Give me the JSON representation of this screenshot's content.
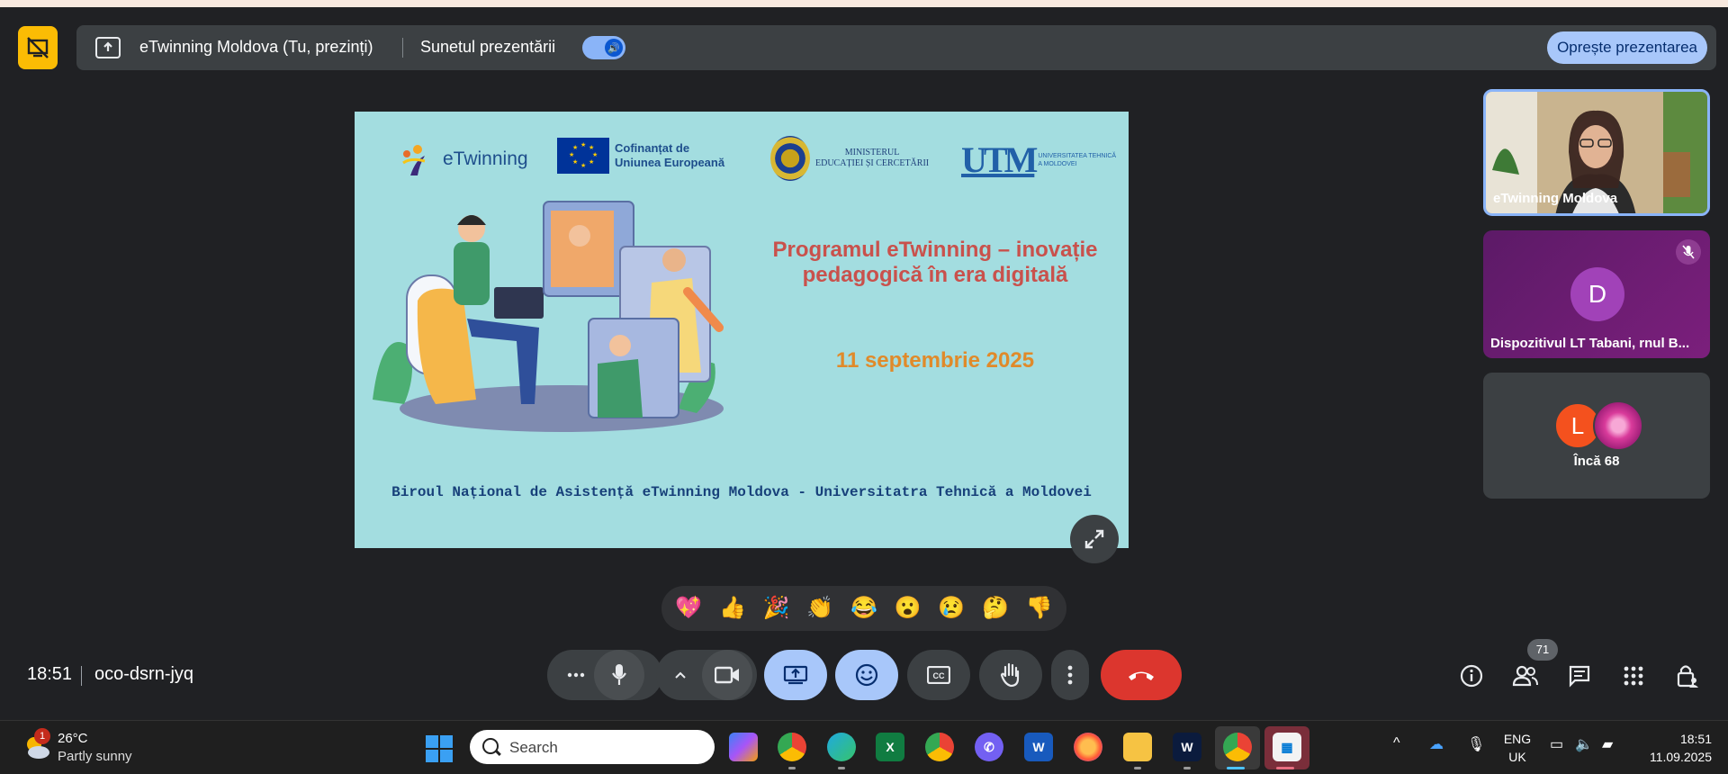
{
  "presentation_banner": {
    "title": "eTwinning Moldova (Tu, prezinți)",
    "sound_label": "Sunetul prezentării",
    "stop_label": "Oprește prezentarea"
  },
  "slide": {
    "etwinning_logo": "eTwinning",
    "eu_logo_line1": "Cofinanțat de",
    "eu_logo_line2": "Uniunea Europeană",
    "ministry_line1": "MINISTERUL",
    "ministry_line2": "EDUCAȚIEI ȘI CERCETĂRII",
    "utm_mark": "UTM",
    "utm_line1": "UNIVERSITATEA TEHNICĂ",
    "utm_line2": "A MOLDOVEI",
    "title_line1": "Programul eTwinning – inovație",
    "title_line2": "pedagogică în era digitală",
    "date": "11 septembrie 2025",
    "footer": "Biroul Național de Asistență eTwinning Moldova - Universitatra Tehnică a Moldovei"
  },
  "participants": {
    "tile1_name": "eTwinning Moldova",
    "tile2_initial": "D",
    "tile2_name": "Dispozitivul LT Tabani, rnul B...",
    "tile3_initial": "L",
    "tile3_more": "Încă 68"
  },
  "reactions": [
    "💖",
    "👍",
    "🎉",
    "👏",
    "😂",
    "😮",
    "😢",
    "🤔",
    "👎"
  ],
  "meeting": {
    "time": "18:51",
    "code": "oco-dsrn-jyq",
    "people_count": "71"
  },
  "taskbar": {
    "weather_badge": "1",
    "temperature": "26°C",
    "condition": "Partly sunny",
    "search_label": "Search",
    "lang_line1": "ENG",
    "lang_line2": "UK",
    "time": "18:51",
    "date": "11.09.2025"
  },
  "colors": {
    "banner_bg": "#3c4043",
    "accent_blue": "#a8c7fa",
    "end_call_red": "#dc362e",
    "present_yellow": "#fbbc04",
    "slide_bg": "#a3dde0"
  }
}
